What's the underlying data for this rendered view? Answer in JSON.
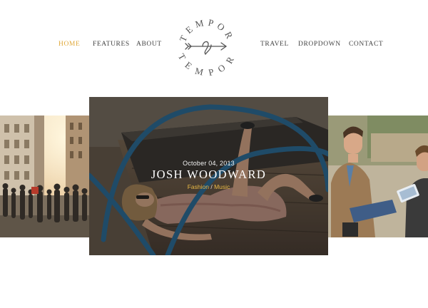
{
  "nav": {
    "left": [
      {
        "label": "HOME",
        "active": true
      },
      {
        "label": "FEATURES",
        "active": false
      },
      {
        "label": "ABOUT",
        "active": false
      }
    ],
    "right": [
      {
        "label": "TRAVEL",
        "active": false
      },
      {
        "label": "DROPDOWN",
        "active": false
      },
      {
        "label": "CONTACT",
        "active": false
      }
    ]
  },
  "logo": {
    "text_top": "TEMPOR",
    "text_bottom": "TEMPOR",
    "icon": "arrow-heart-icon"
  },
  "slider": {
    "featured": {
      "date": "October 04, 2013",
      "title": "JOSH WOODWARD",
      "categories": [
        "Fashion",
        "Music"
      ],
      "separator": " / "
    }
  },
  "colors": {
    "accent": "#e0a93b",
    "nav_text": "#444444",
    "caption_title": "#ffffff"
  }
}
